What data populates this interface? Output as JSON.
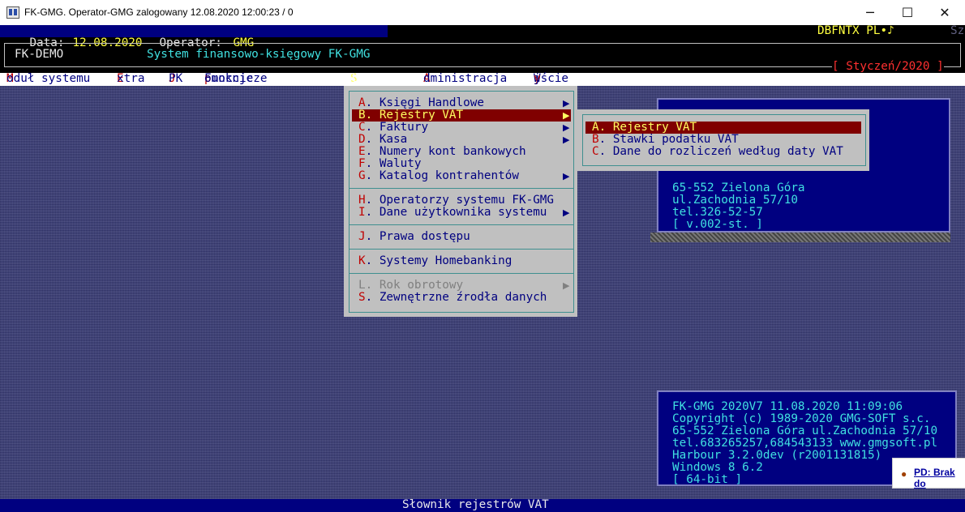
{
  "window": {
    "title": "FK-GMG. Operator-GMG zalogowany 12.08.2020 12:00:23 / 0",
    "minimize": "─",
    "maximize": "☐",
    "close": "✕"
  },
  "header": {
    "data_label": "Data:",
    "date": "12.08.2020",
    "operator_label": "Operator:",
    "operator": "GMG",
    "dbf": "DBFNTX PL•♪",
    "sz": "Sz",
    "company": "FK-DEMO",
    "system_name": "System finansowo-księgowy FK-GMG",
    "period": "[ Styczeń/2020 ]"
  },
  "menubar": {
    "items": [
      {
        "hotkey": "M",
        "rest": "oduł systemu"
      },
      {
        "hotkey": "E",
        "rest": "xtra"
      },
      {
        "hotkey": "J",
        "rest": "PK"
      },
      {
        "pre": "Funkcje ",
        "hotkey": "p",
        "rest": "omocnicze"
      },
      {
        "hotkey": "S",
        "rest": "łowniki"
      },
      {
        "hotkey": "A",
        "rest": "dministracja"
      },
      {
        "pre": "W",
        "hotkey": "y",
        "rest": "jście"
      }
    ]
  },
  "slowniki_menu": {
    "items": [
      {
        "key": "A",
        "label": ". Księgi Handlowe",
        "arrow": "▶"
      },
      {
        "key": "B",
        "label": ". Rejestry VAT",
        "arrow": "▶"
      },
      {
        "key": "C",
        "label": ". Faktury",
        "arrow": "▶"
      },
      {
        "key": "D",
        "label": ". Kasa",
        "arrow": "▶"
      },
      {
        "key": "E",
        "label": ". Numery kont bankowych"
      },
      {
        "key": "F",
        "label": ". Waluty"
      },
      {
        "key": "G",
        "label": ". Katalog kontrahentów",
        "arrow": "▶"
      },
      {
        "key": "H",
        "label": ". Operatorzy systemu FK-GMG"
      },
      {
        "key": "I",
        "label": ". Dane użytkownika systemu",
        "arrow": "▶"
      },
      {
        "key": "J",
        "label": ". Prawa dostępu"
      },
      {
        "key": "K",
        "label": ". Systemy Homebanking"
      },
      {
        "key": "L",
        "label": ". Rok obrotowy",
        "arrow": "▶"
      },
      {
        "key": "S",
        "label": ". Zewnętrzne źrodła danych"
      }
    ]
  },
  "rejestry_submenu": {
    "items": [
      {
        "key": "A",
        "label": ". Rejestry VAT"
      },
      {
        "key": "B",
        "label": ". Stawki podatku VAT"
      },
      {
        "key": "C",
        "label": ". Dane do rozliczeń według daty VAT"
      }
    ]
  },
  "info_top": {
    "lines": [
      "65-552 Zielona Góra",
      "ul.Zachodnia 57/10",
      "tel.326-52-57",
      "[ v.002-st. ]"
    ]
  },
  "info_bottom": {
    "lines": [
      "FK-GMG 2020V7 11.08.2020 11:09:06",
      "Copyright (c) 1989-2020 GMG-SOFT s.c.",
      "65-552 Zielona Góra ul.Zachodnia 57/10",
      "tel.683265257,684543133 www.gmgsoft.pl",
      "Harbour 3.2.0dev (r2001131815)",
      "Windows 8 6.2",
      "[ 64-bit ]"
    ]
  },
  "status": {
    "text": "Słownik rejestrów VAT"
  },
  "notification": {
    "text": "PD: Brak do"
  }
}
